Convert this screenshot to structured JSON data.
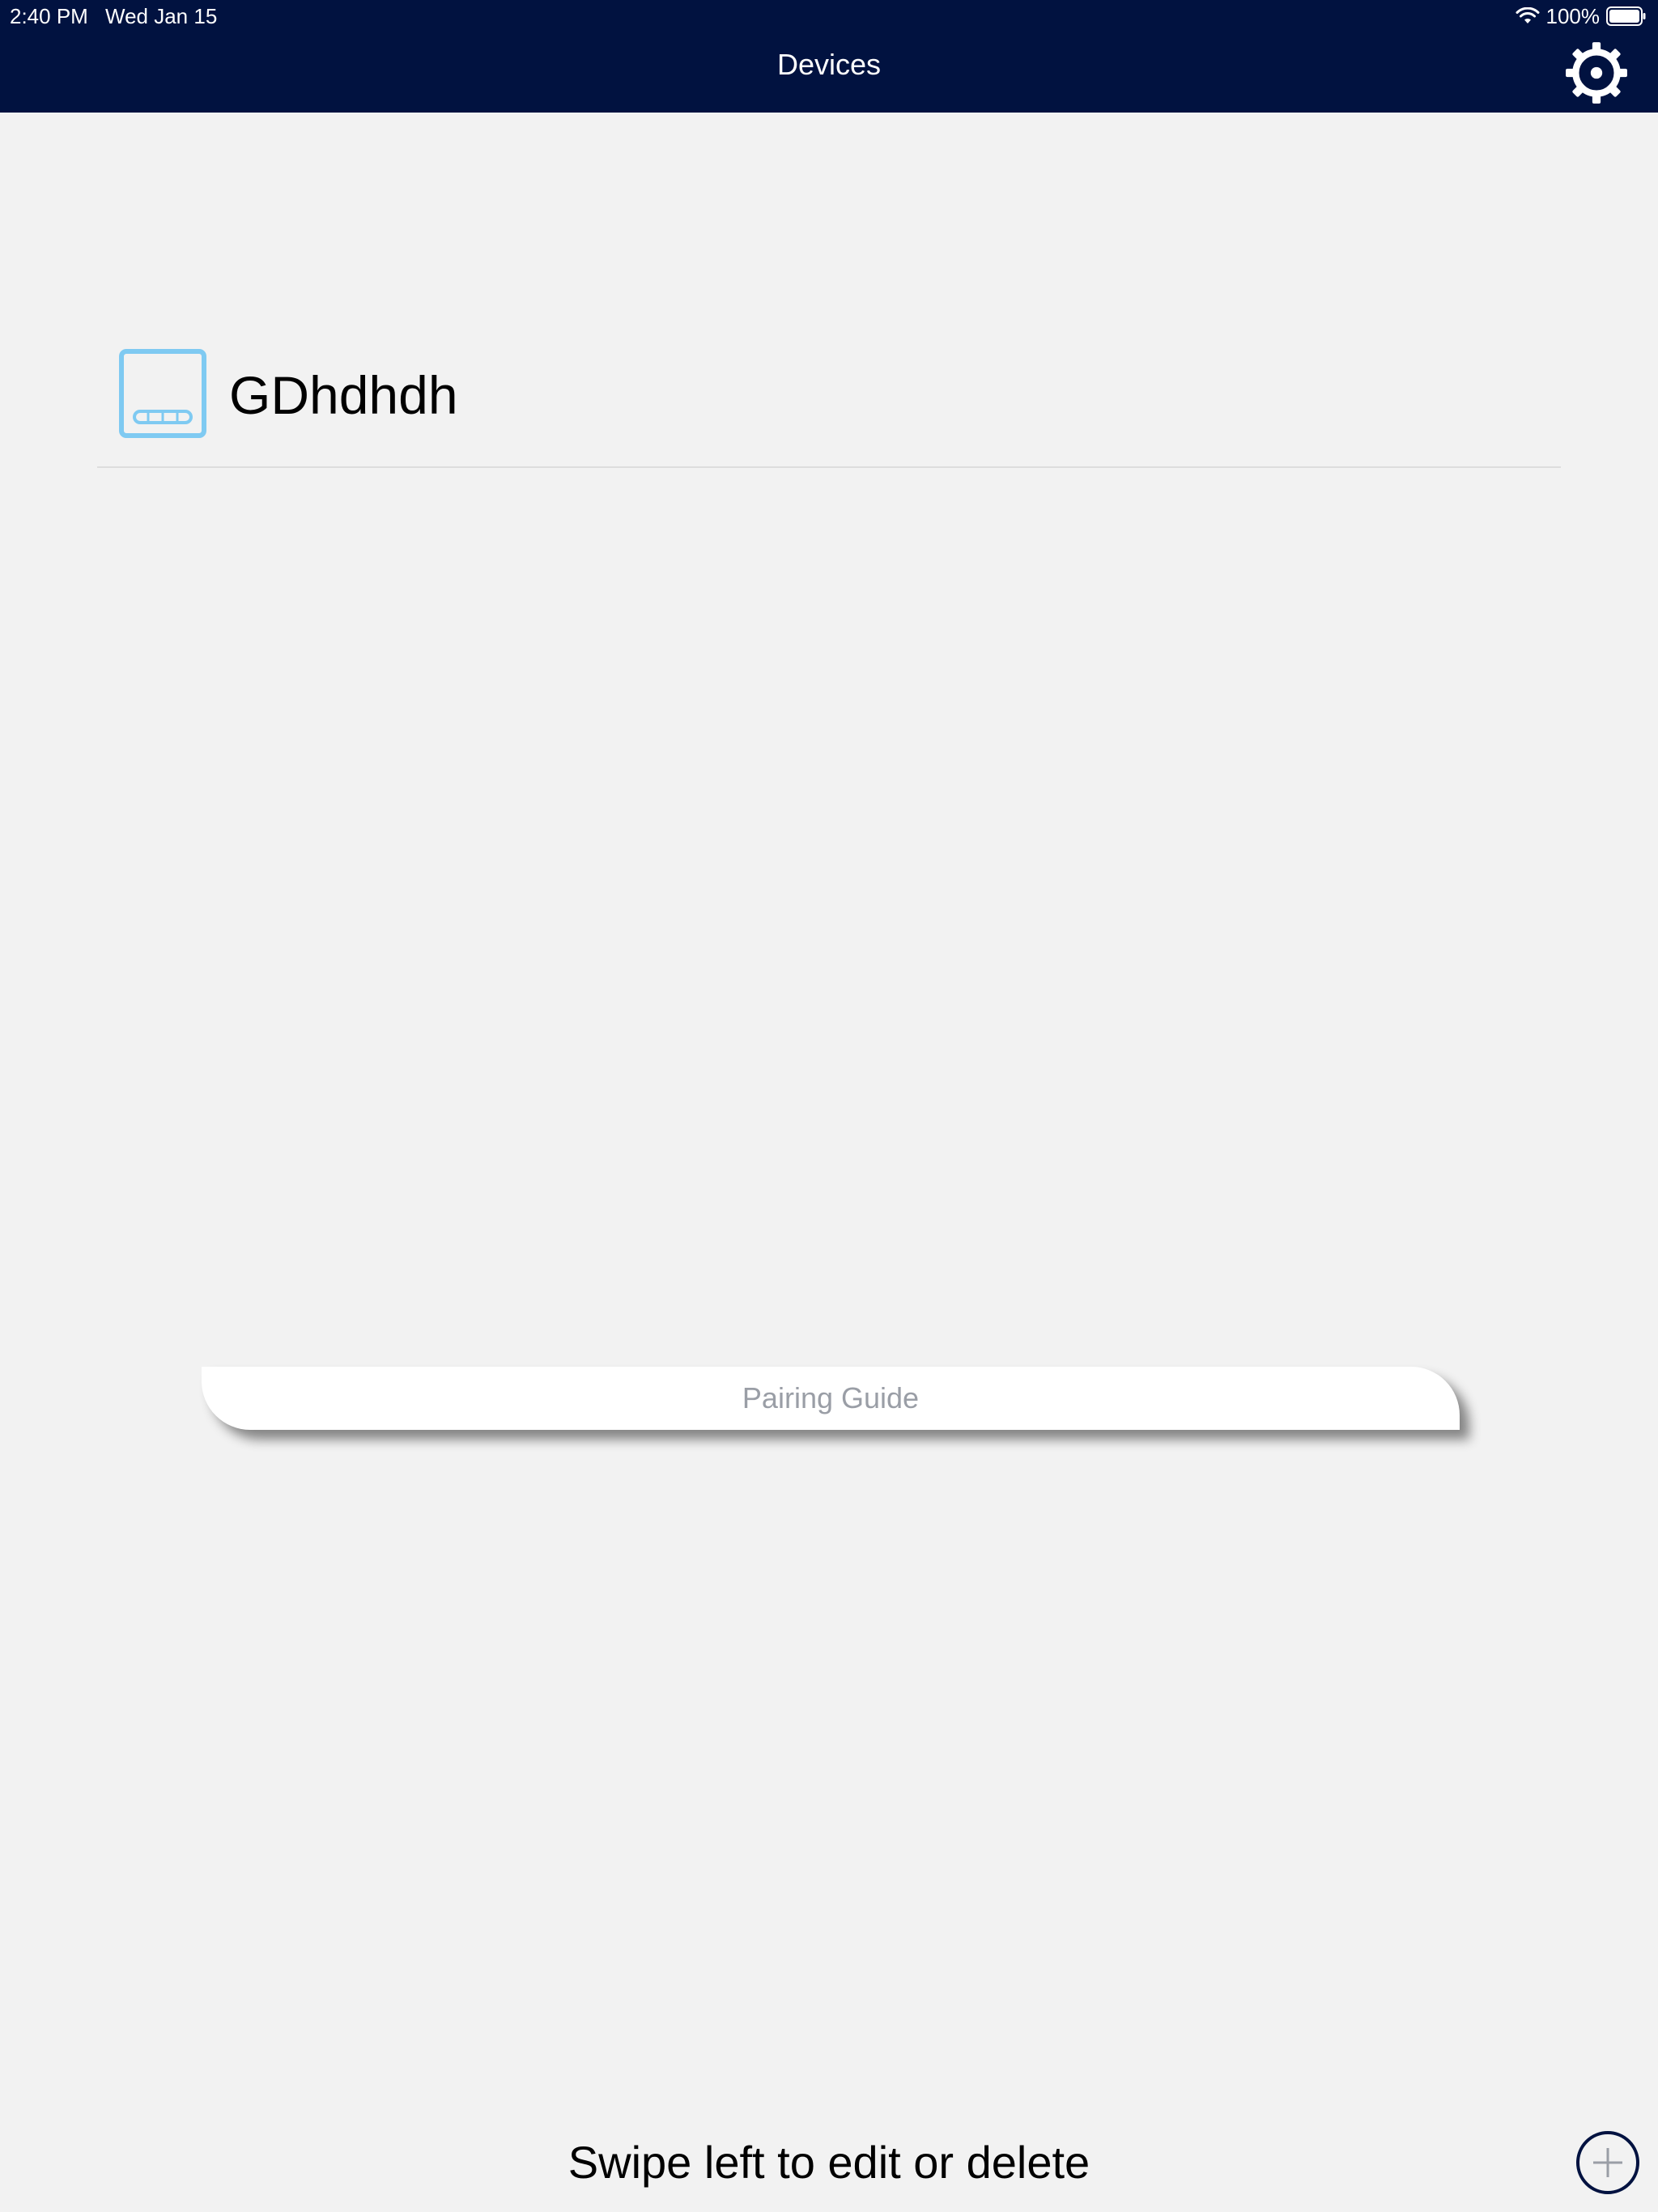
{
  "status_bar": {
    "time": "2:40 PM",
    "date": "Wed Jan 15",
    "battery": "100%"
  },
  "header": {
    "title": "Devices",
    "settings_icon": "gear-icon"
  },
  "devices": [
    {
      "name": "GDhdhdh",
      "icon": "device-icon"
    }
  ],
  "pairing_guide": {
    "label": "Pairing Guide"
  },
  "footer": {
    "hint": "Swipe left to edit or delete",
    "add_icon": "plus-circle-icon"
  },
  "colors": {
    "header_bg": "#011240",
    "background": "#f2f2f2",
    "device_icon": "#7fcaf2",
    "pairing_text": "#9a9ea6"
  }
}
